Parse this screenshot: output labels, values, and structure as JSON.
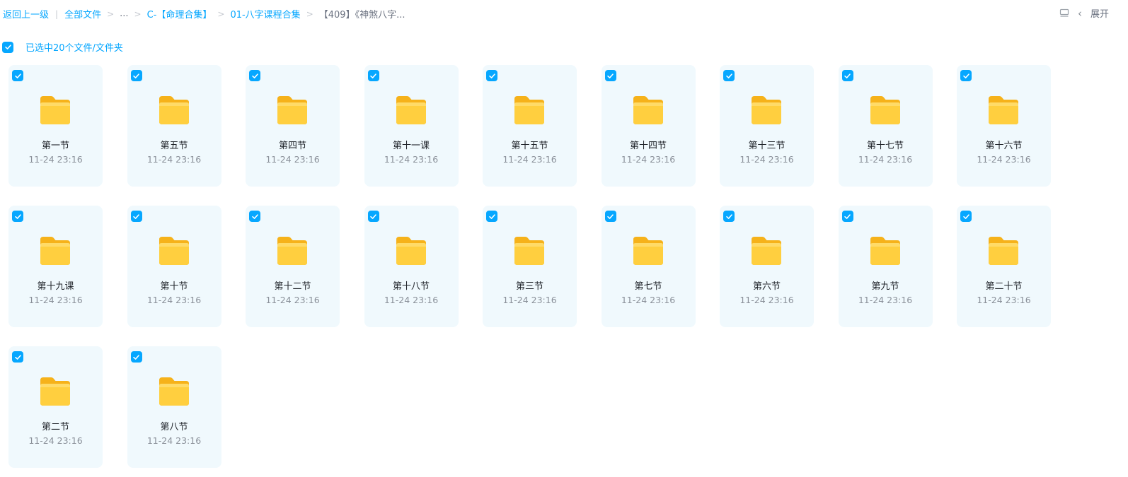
{
  "breadcrumb": {
    "back": "返回上一级",
    "all_files": "全部文件",
    "ellipsis": "...",
    "level1": "C-【命理合集】",
    "level2": "01-八字课程合集",
    "current": "【409】《神煞八字..."
  },
  "toolbar": {
    "expand_label": "展开"
  },
  "selection": {
    "text": "已选中20个文件/文件夹"
  },
  "colors": {
    "accent": "#06a7ff",
    "tile_bg": "#f0f9fd",
    "folder_yellow": "#ffce3d"
  },
  "folders": [
    {
      "name": "第一节",
      "date": "11-24 23:16"
    },
    {
      "name": "第五节",
      "date": "11-24 23:16"
    },
    {
      "name": "第四节",
      "date": "11-24 23:16"
    },
    {
      "name": "第十一课",
      "date": "11-24 23:16"
    },
    {
      "name": "第十五节",
      "date": "11-24 23:16"
    },
    {
      "name": "第十四节",
      "date": "11-24 23:16"
    },
    {
      "name": "第十三节",
      "date": "11-24 23:16"
    },
    {
      "name": "第十七节",
      "date": "11-24 23:16"
    },
    {
      "name": "第十六节",
      "date": "11-24 23:16"
    },
    {
      "name": "第十九课",
      "date": "11-24 23:16"
    },
    {
      "name": "第十节",
      "date": "11-24 23:16"
    },
    {
      "name": "第十二节",
      "date": "11-24 23:16"
    },
    {
      "name": "第十八节",
      "date": "11-24 23:16"
    },
    {
      "name": "第三节",
      "date": "11-24 23:16"
    },
    {
      "name": "第七节",
      "date": "11-24 23:16"
    },
    {
      "name": "第六节",
      "date": "11-24 23:16"
    },
    {
      "name": "第九节",
      "date": "11-24 23:16"
    },
    {
      "name": "第二十节",
      "date": "11-24 23:16"
    },
    {
      "name": "第二节",
      "date": "11-24 23:16"
    },
    {
      "name": "第八节",
      "date": "11-24 23:16"
    }
  ]
}
